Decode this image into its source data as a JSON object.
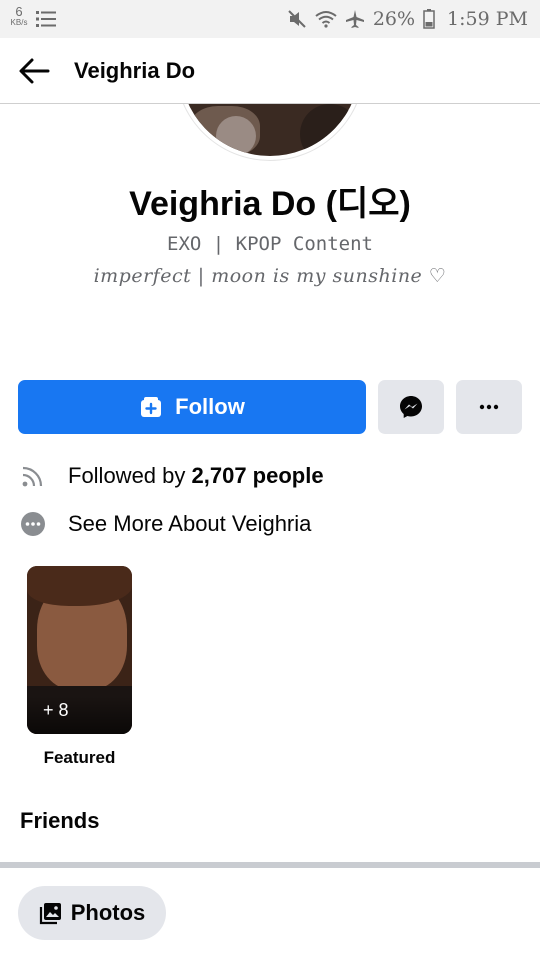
{
  "status_bar": {
    "speed_value": "6",
    "speed_unit": "KB/s",
    "battery": "26%",
    "time": "1:59 PM",
    "icons": [
      "list-icon",
      "mute-icon",
      "wifi-icon",
      "airplane-icon",
      "battery-icon"
    ]
  },
  "header": {
    "title": "Veighria Do",
    "back_icon": "back-arrow-icon"
  },
  "profile": {
    "name": "Veighria Do (디오)",
    "subtitle": "EXO | KPOP Content",
    "bio": "imperfect | moon is my sunshine ♡"
  },
  "actions": {
    "follow_label": "Follow",
    "follow_icon": "follow-plus-icon",
    "message_icon": "messenger-icon",
    "more_icon": "more-dots-icon",
    "accent_color": "#1877f2",
    "secondary_bg": "#e4e6eb"
  },
  "info": {
    "followers_prefix": "Followed by ",
    "followers_count": "2,707 people",
    "followers_icon": "rss-icon",
    "about_text": "See More About Veighria",
    "about_icon": "more-circle-icon"
  },
  "featured": {
    "count_label": "+ 8",
    "label": "Featured"
  },
  "friends": {
    "title": "Friends"
  },
  "photos": {
    "label": "Photos",
    "icon": "photos-icon"
  }
}
